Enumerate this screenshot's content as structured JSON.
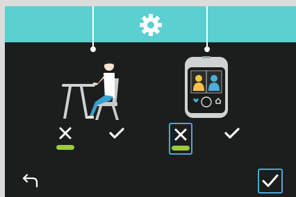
{
  "header": {
    "icon": "gear-icon",
    "accent": "#5ccfd1"
  },
  "scenes": [
    {
      "name": "person-at-desk",
      "options": [
        {
          "icon": "cross-icon",
          "selected": false,
          "indicator": true
        },
        {
          "icon": "check-icon",
          "selected": false,
          "indicator": false
        }
      ]
    },
    {
      "name": "smartwatch-with-users",
      "options": [
        {
          "icon": "cross-icon",
          "selected": true,
          "indicator": true
        },
        {
          "icon": "check-icon",
          "selected": false,
          "indicator": false
        }
      ]
    }
  ],
  "footer": {
    "back_icon": "back-arrow-icon",
    "confirm_icon": "check-icon"
  },
  "colors": {
    "background": "#1c1e1d",
    "header": "#5ccfd1",
    "indicator": "#9ccc3c",
    "selection": "#4aa8d8",
    "person_left": "#f6c244",
    "person_right": "#4aaed8"
  }
}
